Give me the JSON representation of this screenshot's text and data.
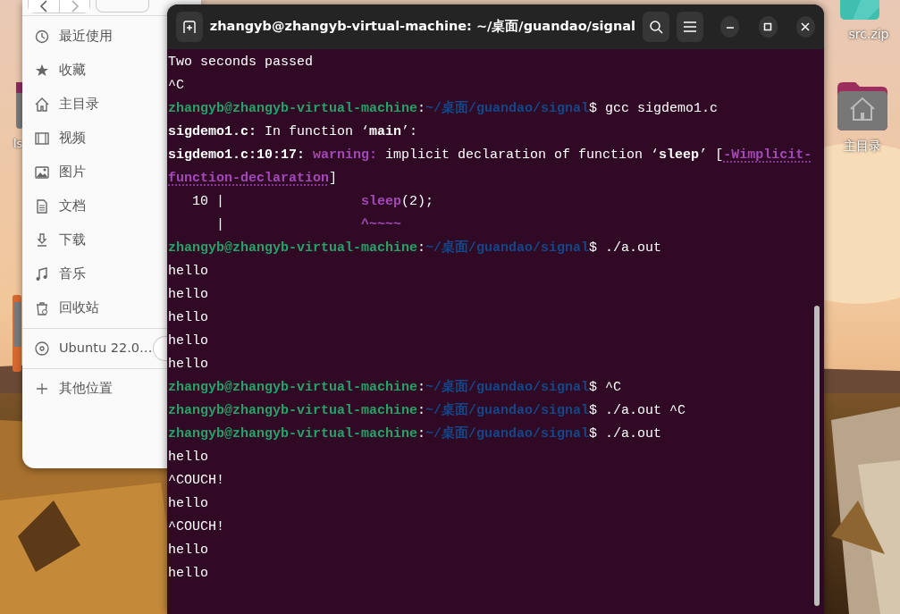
{
  "desktop": {
    "left_labels": [
      "ls"
    ],
    "icons": [
      {
        "kind": "zip",
        "label": "src.zip"
      },
      {
        "kind": "home",
        "label": "主目录"
      }
    ]
  },
  "file_manager": {
    "places": [
      {
        "kind": "recent",
        "label": "最近使用"
      },
      {
        "kind": "star",
        "label": "收藏"
      },
      {
        "kind": "home",
        "label": "主目录"
      },
      {
        "kind": "video",
        "label": "视频"
      },
      {
        "kind": "picture",
        "label": "图片"
      },
      {
        "kind": "document",
        "label": "文档"
      },
      {
        "kind": "download",
        "label": "下载"
      },
      {
        "kind": "music",
        "label": "音乐"
      },
      {
        "kind": "trash",
        "label": "回收站"
      }
    ],
    "devices": [
      {
        "kind": "disc",
        "label": "Ubuntu 22.0…"
      }
    ],
    "other": [
      {
        "kind": "plus",
        "label": "其他位置"
      }
    ]
  },
  "terminal": {
    "title": "zhangyb@zhangyb-virtual-machine: ~/桌面/guandao/signal",
    "lines": [
      [
        {
          "kind": "text",
          "text": "Two seconds passed"
        }
      ],
      [
        {
          "kind": "text",
          "text": "^C"
        }
      ],
      [
        {
          "kind": "user",
          "text": "zhangyb@zhangyb-virtual-machine"
        },
        {
          "kind": "text",
          "text": ":"
        },
        {
          "kind": "path",
          "text": "~/桌面/guandao/signal"
        },
        {
          "kind": "text",
          "text": "$ gcc sigdemo1.c"
        }
      ],
      [
        {
          "kind": "bold",
          "text": "sigdemo1.c:"
        },
        {
          "kind": "text",
          "text": " In function ‘"
        },
        {
          "kind": "bold",
          "text": "main"
        },
        {
          "kind": "text",
          "text": "’:"
        }
      ],
      [
        {
          "kind": "bold",
          "text": "sigdemo1.c:10:17: "
        },
        {
          "kind": "warning",
          "text": "warning:"
        },
        {
          "kind": "text",
          "text": " implicit declaration of function ‘"
        },
        {
          "kind": "bold",
          "text": "sleep"
        },
        {
          "kind": "text",
          "text": "’ ["
        },
        {
          "kind": "link",
          "text": "-Wimplicit-"
        }
      ],
      [
        {
          "kind": "link",
          "text": "function-declaration"
        },
        {
          "kind": "text",
          "text": "]"
        }
      ],
      [
        {
          "kind": "text",
          "text": "   10 |                 "
        },
        {
          "kind": "warning",
          "text": "sleep"
        },
        {
          "kind": "text",
          "text": "(2);"
        }
      ],
      [
        {
          "kind": "text",
          "text": "      |                 "
        },
        {
          "kind": "warning",
          "text": "^~~~~"
        }
      ],
      [
        {
          "kind": "user",
          "text": "zhangyb@zhangyb-virtual-machine"
        },
        {
          "kind": "text",
          "text": ":"
        },
        {
          "kind": "path",
          "text": "~/桌面/guandao/signal"
        },
        {
          "kind": "text",
          "text": "$ ./a.out"
        }
      ],
      [
        {
          "kind": "text",
          "text": "hello"
        }
      ],
      [
        {
          "kind": "text",
          "text": "hello"
        }
      ],
      [
        {
          "kind": "text",
          "text": "hello"
        }
      ],
      [
        {
          "kind": "text",
          "text": "hello"
        }
      ],
      [
        {
          "kind": "text",
          "text": "hello"
        }
      ],
      [
        {
          "kind": "user",
          "text": "zhangyb@zhangyb-virtual-machine"
        },
        {
          "kind": "text",
          "text": ":"
        },
        {
          "kind": "path",
          "text": "~/桌面/guandao/signal"
        },
        {
          "kind": "text",
          "text": "$ ^C"
        }
      ],
      [
        {
          "kind": "user",
          "text": "zhangyb@zhangyb-virtual-machine"
        },
        {
          "kind": "text",
          "text": ":"
        },
        {
          "kind": "path",
          "text": "~/桌面/guandao/signal"
        },
        {
          "kind": "text",
          "text": "$ ./a.out ^C"
        }
      ],
      [
        {
          "kind": "user",
          "text": "zhangyb@zhangyb-virtual-machine"
        },
        {
          "kind": "text",
          "text": ":"
        },
        {
          "kind": "path",
          "text": "~/桌面/guandao/signal"
        },
        {
          "kind": "text",
          "text": "$ ./a.out"
        }
      ],
      [
        {
          "kind": "text",
          "text": "hello"
        }
      ],
      [
        {
          "kind": "text",
          "text": "^COUCH!"
        }
      ],
      [
        {
          "kind": "text",
          "text": "hello"
        }
      ],
      [
        {
          "kind": "text",
          "text": "^COUCH!"
        }
      ],
      [
        {
          "kind": "text",
          "text": "hello"
        }
      ],
      [
        {
          "kind": "text",
          "text": "hello"
        }
      ]
    ]
  }
}
